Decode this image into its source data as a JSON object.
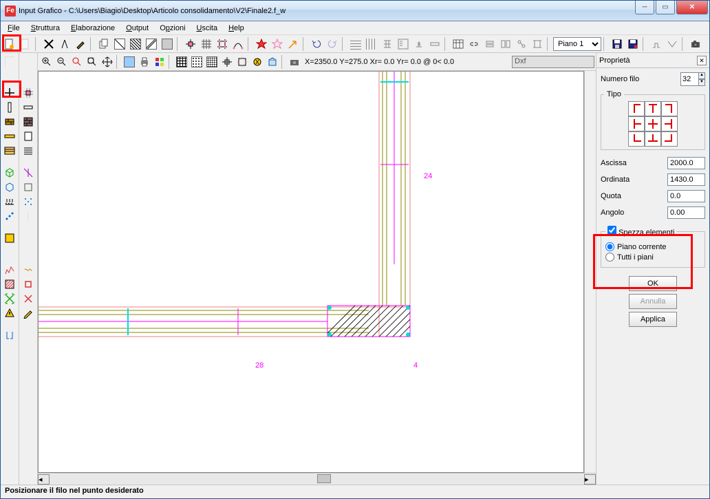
{
  "title": "Input Grafico - C:\\Users\\Biagio\\Desktop\\Articolo consolidamento\\V2\\Finale2.f_w",
  "menu": [
    "File",
    "Struttura",
    "Elaborazione",
    "Output",
    "Opzioni",
    "Uscita",
    "Help"
  ],
  "floor_combo": "Piano 1",
  "coords": "X=2350.0 Y=275.0 Xr=  0.0 Yr=  0.0 @  0< 0.0",
  "dxf_label": "Dxf",
  "panel": {
    "title": "Proprietà",
    "numero_filo_label": "Numero filo",
    "numero_filo": "32",
    "tipo_legend": "Tipo",
    "ascissa_label": "Ascissa",
    "ascissa": "2000.0",
    "ordinata_label": "Ordinata",
    "ordinata": "1430.0",
    "quota_label": "Quota",
    "quota": "0.0",
    "angolo_label": "Angolo",
    "angolo": "0.00",
    "spezza_legend": "Spezza elementi",
    "spezza_check_label": "Spezza elementi",
    "radio1": "Piano corrente",
    "radio2": "Tutti i piani",
    "ok": "OK",
    "annulla": "Annulla",
    "applica": "Applica"
  },
  "canvas_labels": {
    "n24": "24",
    "n28": "28",
    "n4": "4"
  },
  "status": "Posizionare il filo nel punto desiderato"
}
